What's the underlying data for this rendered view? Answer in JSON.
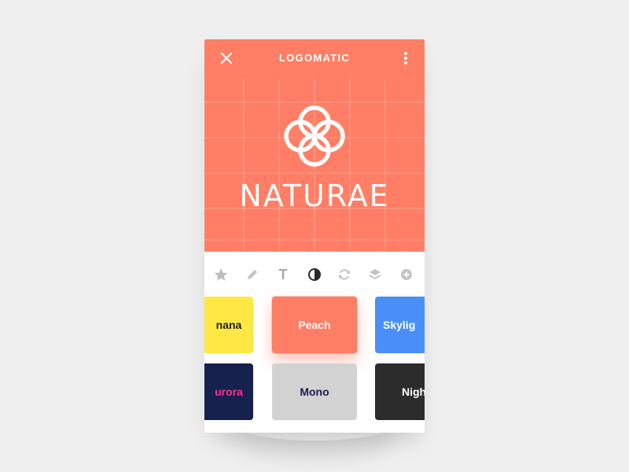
{
  "app": {
    "title": "LOGOMATIC",
    "accent": "#ff7e65",
    "close_icon": "close-icon",
    "more_icon": "more-vertical-icon"
  },
  "canvas": {
    "background": "#ff7e65",
    "brand_name": "NATURAE",
    "logo_icon": "flower-knot-icon"
  },
  "toolbar": {
    "tools": [
      {
        "name": "star-icon",
        "active": false
      },
      {
        "name": "pencil-icon",
        "active": false
      },
      {
        "name": "text-icon",
        "label": "T",
        "active": false
      },
      {
        "name": "contrast-icon",
        "active": true
      },
      {
        "name": "refresh-icon",
        "active": false
      },
      {
        "name": "layers-icon",
        "active": false
      },
      {
        "name": "add-circle-icon",
        "active": false
      }
    ]
  },
  "themes": {
    "row1": [
      {
        "label": "nana",
        "bg": "#ffe844",
        "fg": "#1d1d1d"
      },
      {
        "label": "Peach",
        "bg": "#ff7e65",
        "fg": "#ffffff",
        "selected": true
      },
      {
        "label": "Skylig",
        "bg": "#4a8ef8",
        "fg": "#ffffff"
      }
    ],
    "row2": [
      {
        "label": "urora",
        "bg": "#16214e",
        "fg": "#ff2f8a"
      },
      {
        "label": "Mono",
        "bg": "#d2d2d2",
        "fg": "#1b1f4e"
      },
      {
        "label": "Nigh",
        "bg": "#2c2c2c",
        "fg": "#ffffff"
      }
    ]
  }
}
